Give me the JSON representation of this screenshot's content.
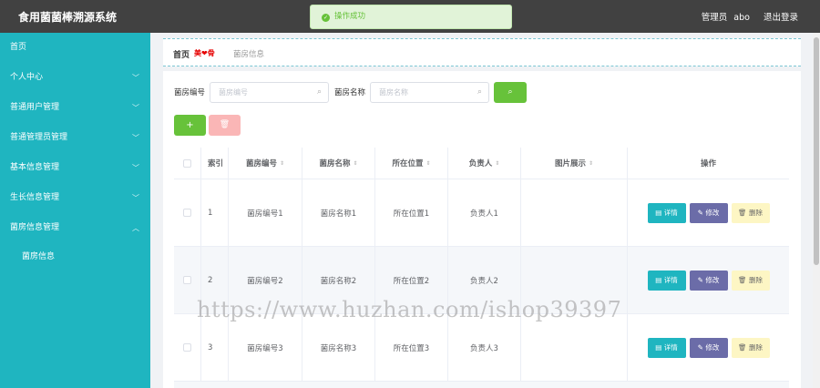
{
  "app": {
    "title": "食用菌菌棒溯源系统"
  },
  "header": {
    "role": "管理员",
    "username": "abo",
    "logout": "退出登录"
  },
  "toast": {
    "message": "操作成功"
  },
  "sidebar": {
    "items": [
      {
        "label": "首页"
      },
      {
        "label": "个人中心"
      },
      {
        "label": "普通用户管理"
      },
      {
        "label": "普通管理员管理"
      },
      {
        "label": "基本信息管理"
      },
      {
        "label": "生长信息管理"
      },
      {
        "label": "菌房信息管理"
      }
    ],
    "submenu": [
      {
        "label": "菌房信息"
      }
    ]
  },
  "breadcrumb": {
    "home": "首页",
    "separator": "美❤骨",
    "current": "菌房信息"
  },
  "search": {
    "code_label": "菌房编号",
    "code_placeholder": "菌房编号",
    "name_label": "菌房名称",
    "name_placeholder": "菌房名称"
  },
  "toolbar": {
    "add": "+",
    "delete": "🗑"
  },
  "table": {
    "headers": [
      "索引",
      "菌房编号",
      "菌房名称",
      "所在位置",
      "负责人",
      "图片展示",
      "操作"
    ],
    "rows": [
      {
        "index": "1",
        "code": "菌房编号1",
        "name": "菌房名称1",
        "location": "所在位置1",
        "owner": "负责人1"
      },
      {
        "index": "2",
        "code": "菌房编号2",
        "name": "菌房名称2",
        "location": "所在位置2",
        "owner": "负责人2"
      },
      {
        "index": "3",
        "code": "菌房编号3",
        "name": "菌房名称3",
        "location": "所在位置3",
        "owner": "负责人3"
      }
    ],
    "actions": {
      "detail": "详情",
      "edit": "修改",
      "delete": "删除"
    }
  },
  "watermark": "https://www.huzhan.com/ishop39397",
  "colors": {
    "sidebar": "#1fb5c0",
    "topbar": "#414141",
    "success": "#67c23a",
    "edit": "#6b6ca8",
    "delete_bg": "#fdf6c4"
  }
}
